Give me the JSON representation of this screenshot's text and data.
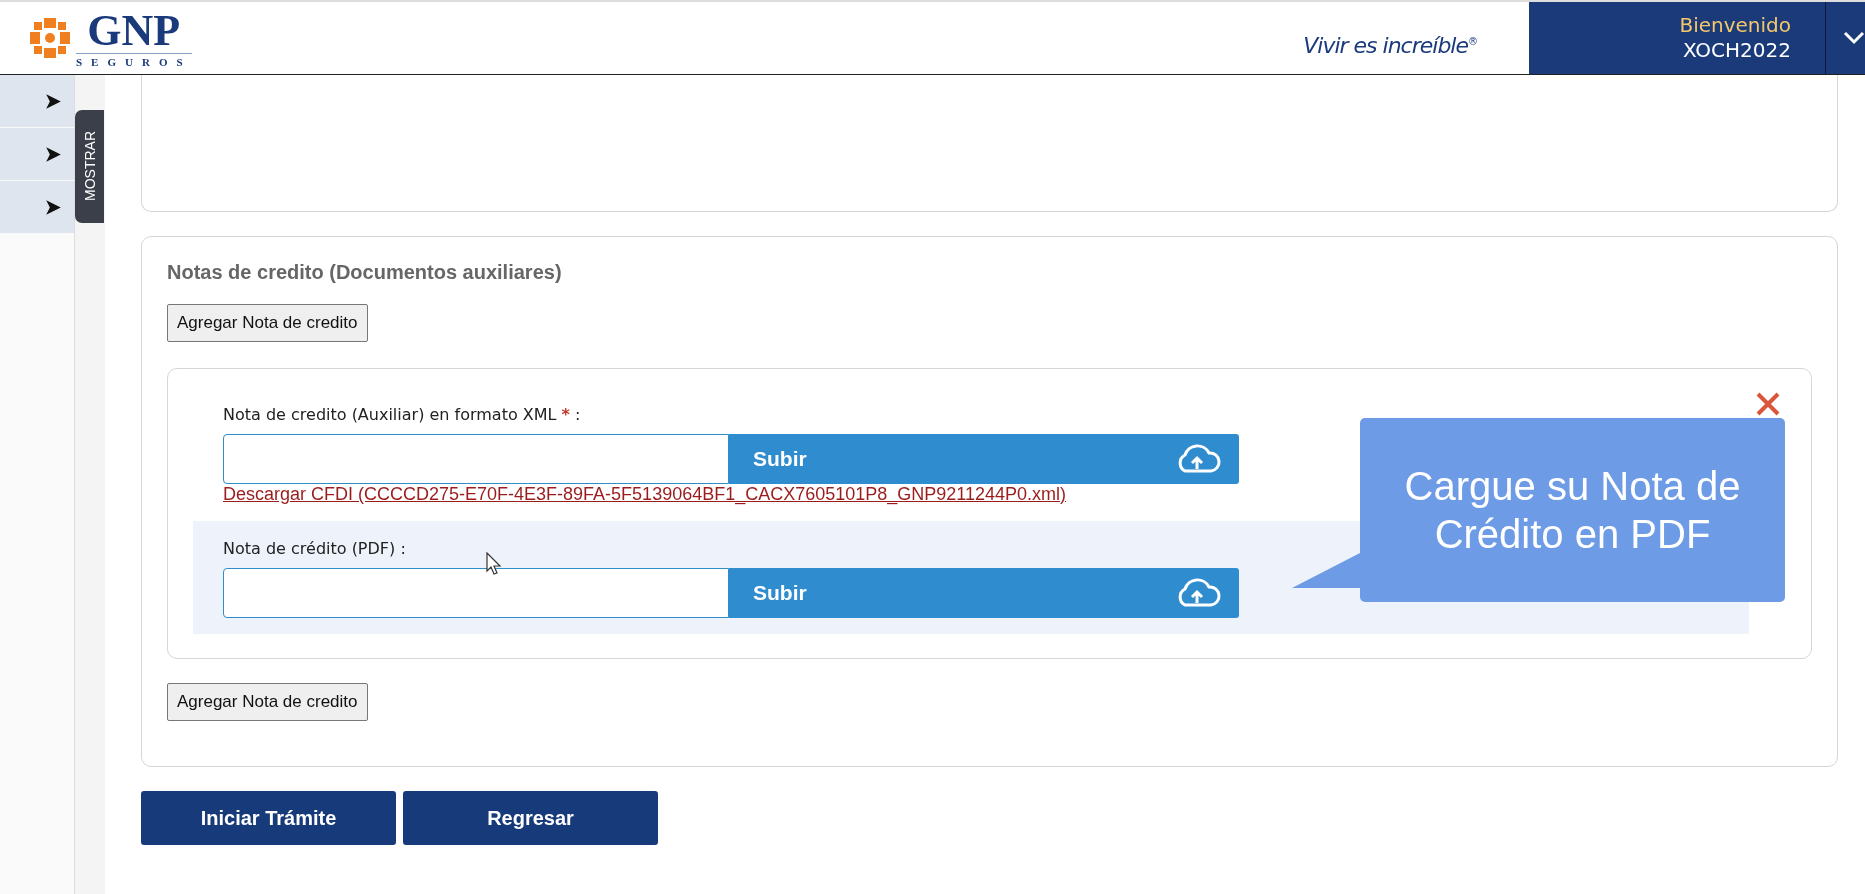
{
  "header": {
    "brand": "GNP",
    "brand_sub": "SEGUROS",
    "slogan": "Vivir es increíble",
    "slogan_mark": "®",
    "welcome": "Bienvenido",
    "user": "XOCH2022"
  },
  "sidebar": {
    "items": [
      {
        "expanded": false
      },
      {
        "expanded": false
      },
      {
        "expanded": false
      }
    ],
    "toggle": "MOSTRAR"
  },
  "section": {
    "title": "Notas de credito (Documentos auxiliares)",
    "add_button": "Agregar Nota de credito",
    "notes": [
      {
        "fields": [
          {
            "label": "Nota de credito (Auxiliar) en formato XML",
            "required_mark": "*",
            "separator": ":",
            "button": "Subir",
            "link": "Descargar CFDI (CCCCD275-E70F-4E3F-89FA-5F5139064BF1_CACX7605101P8_GNP9211244P0.xml)",
            "highlighted": false
          },
          {
            "label": "Nota de crédito (PDF)",
            "separator": ":",
            "button": "Subir",
            "highlighted": true
          }
        ]
      }
    ],
    "add_button_bottom": "Agregar Nota de credito"
  },
  "actions": [
    {
      "label": "Iniciar Trámite"
    },
    {
      "label": "Regresar"
    }
  ],
  "callout": {
    "text": "Cargue su Nota de Crédito en PDF"
  }
}
